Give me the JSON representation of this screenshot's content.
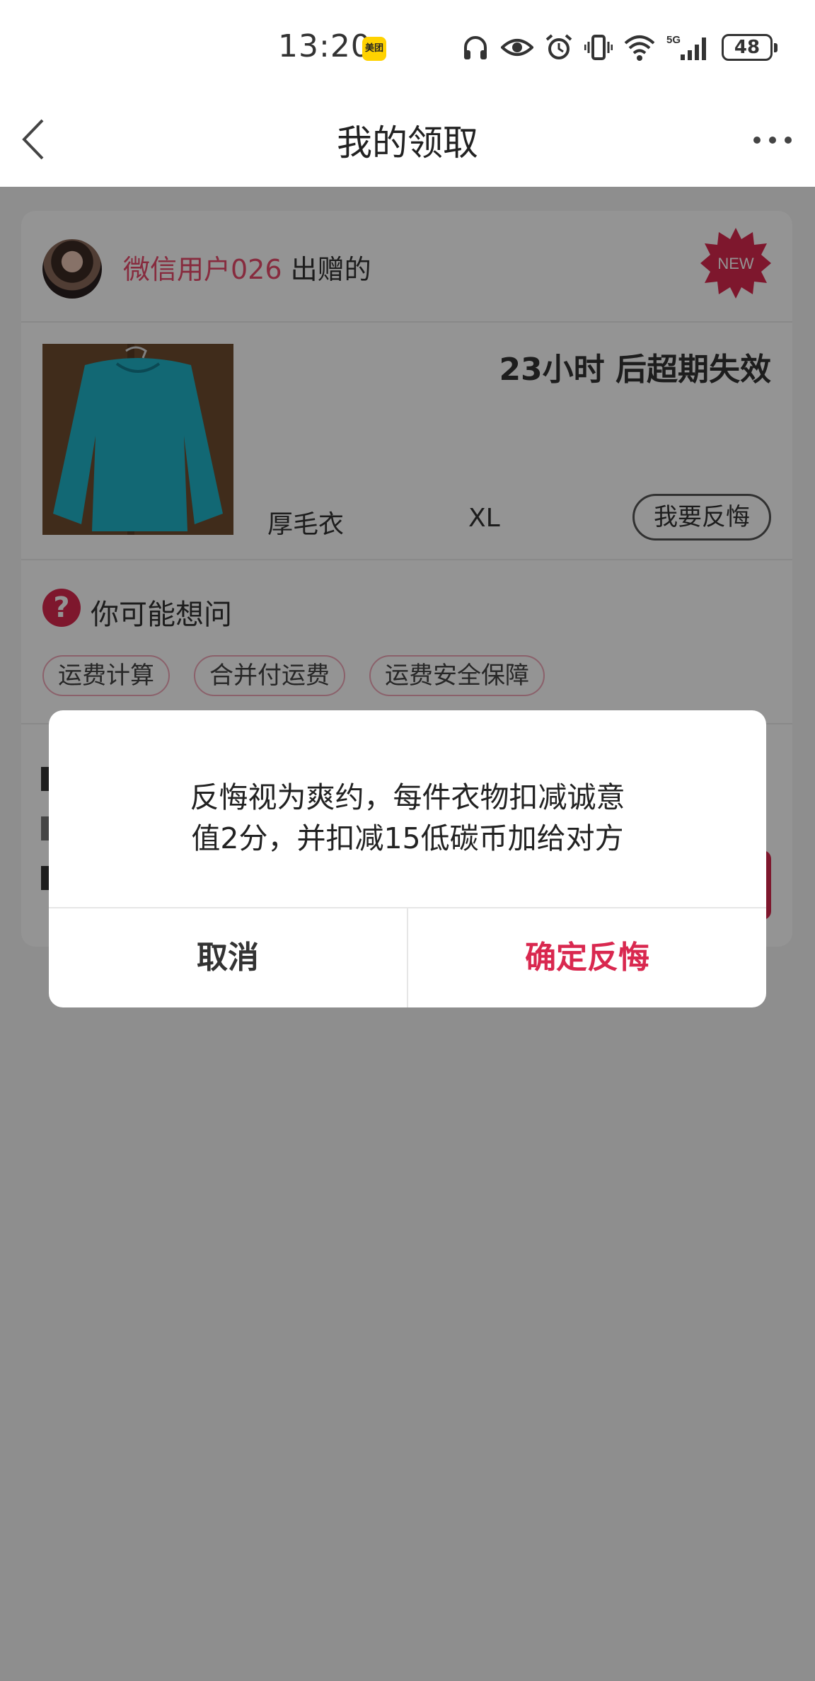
{
  "status_bar": {
    "time": "13:20",
    "meituan_label": "美团",
    "network": "5G",
    "battery": "48"
  },
  "nav": {
    "title": "我的领取"
  },
  "card": {
    "giver_name": "微信用户026",
    "giver_suffix": " 出赠的",
    "badge": "NEW",
    "expire_text": "23小时 后超期失效",
    "item_name": "厚毛衣",
    "item_size": "XL",
    "regret_button": "我要反悔"
  },
  "faq": {
    "icon": "?",
    "title": "你可能想问",
    "tags": [
      "运费计算",
      "合并付运费",
      "运费安全保障"
    ]
  },
  "dialog": {
    "message_line1": "反悔视为爽约，每件衣物扣减诚意",
    "message_line2": "值2分，并扣减15低碳币加给对方",
    "cancel": "取消",
    "confirm": "确定反悔"
  },
  "colors": {
    "accent": "#d9284f",
    "giver_name": "#e84a6c",
    "overlay": "rgba(0,0,0,0.42)"
  }
}
